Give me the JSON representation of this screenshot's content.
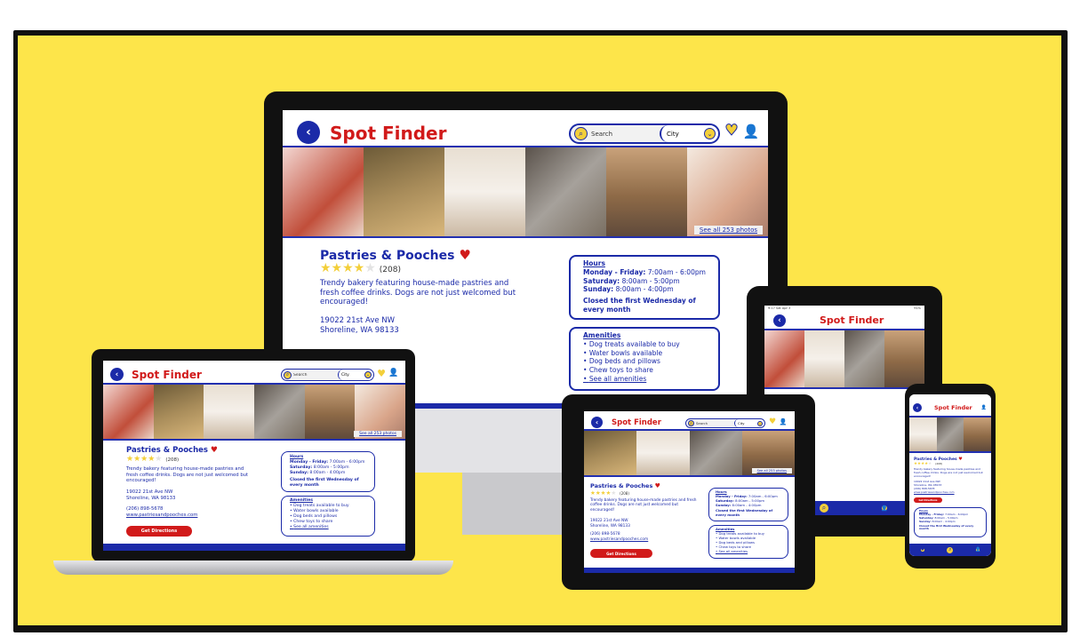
{
  "app": {
    "name": "Spot Finder"
  },
  "search": {
    "placeholder": "Search",
    "city_label": "City"
  },
  "gallery": {
    "see_all": "See all 253 photos"
  },
  "place": {
    "name": "Pastries & Pooches",
    "review_count": "(208)",
    "rating": 4,
    "description": "Trendy bakery featuring house-made pastries and fresh coffee drinks. Dogs are not just welcomed but encouraged!",
    "address_line1": "19022 21st Ave NW",
    "address_line2": "Shoreline, WA 98133",
    "phone": "(206) 898-5678",
    "website": "www.pastriesandpooches.com",
    "directions_button": "Get Directions"
  },
  "hours": {
    "title": "Hours",
    "weekday_label": "Monday - Friday:",
    "weekday_value": "7:00am - 6:00pm",
    "saturday_label": "Saturday:",
    "saturday_value": "8:00am - 5:00pm",
    "sunday_label": "Sunday:",
    "sunday_value": "8:00am - 4:00pm",
    "note": "Closed the first Wednesday of every month"
  },
  "amenities": {
    "title": "Amenities",
    "items": [
      "Dog treats available to buy",
      "Water bowls available",
      "Dog beds and pillows",
      "Chew toys to share"
    ],
    "see_all": "See all amenities"
  },
  "status_bar": {
    "carrier": "9:17  Sat Apr 3",
    "battery": "91%"
  },
  "colors": {
    "brand_blue": "#1b2aa8",
    "brand_red": "#d11a1a",
    "accent_yellow": "#f3cf3a",
    "background_yellow": "#fde54a"
  },
  "icons": [
    "back-arrow-icon",
    "search-icon",
    "chevron-down-icon",
    "heart-icon",
    "user-icon",
    "star-icon"
  ]
}
